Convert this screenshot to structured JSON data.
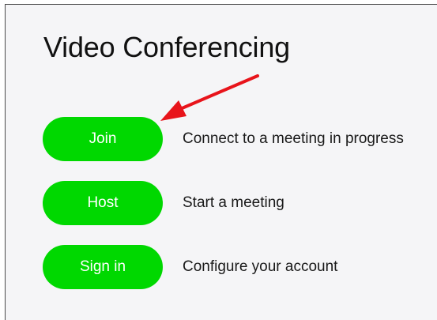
{
  "header": {
    "title": "Video Conferencing"
  },
  "actions": [
    {
      "label": "Join",
      "description": "Connect to a meeting in progress"
    },
    {
      "label": "Host",
      "description": "Start a meeting"
    },
    {
      "label": "Sign in",
      "description": "Configure your account"
    }
  ],
  "colors": {
    "button_green": "#00d800",
    "annotation_red": "#e8141b",
    "panel_bg": "#f5f5f7"
  },
  "annotation": {
    "icon": "red-arrow-icon"
  }
}
